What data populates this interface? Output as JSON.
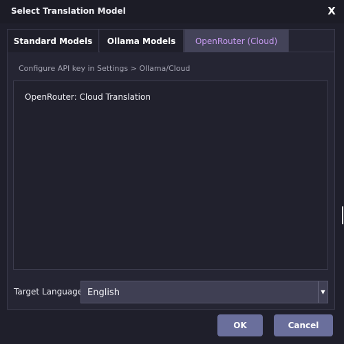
{
  "window": {
    "title": "Select Translation Model",
    "close_label": "X"
  },
  "tabs": [
    {
      "label": "Standard Models",
      "active": false
    },
    {
      "label": "Ollama Models",
      "active": false
    },
    {
      "label": "OpenRouter (Cloud)",
      "active": true
    }
  ],
  "content": {
    "hint": "Configure API key in Settings > Ollama/Cloud",
    "entry": "OpenRouter: Cloud Translation"
  },
  "target_language": {
    "label": "Target Language:",
    "value": "English",
    "arrow_icon": "chevron-down-icon"
  },
  "buttons": {
    "ok_label": "OK",
    "cancel_label": "Cancel"
  },
  "colors": {
    "background": "#1f1f2b",
    "active_tab": "#434358",
    "active_tab_text": "#c89bf2",
    "button": "#6a6f9c"
  }
}
